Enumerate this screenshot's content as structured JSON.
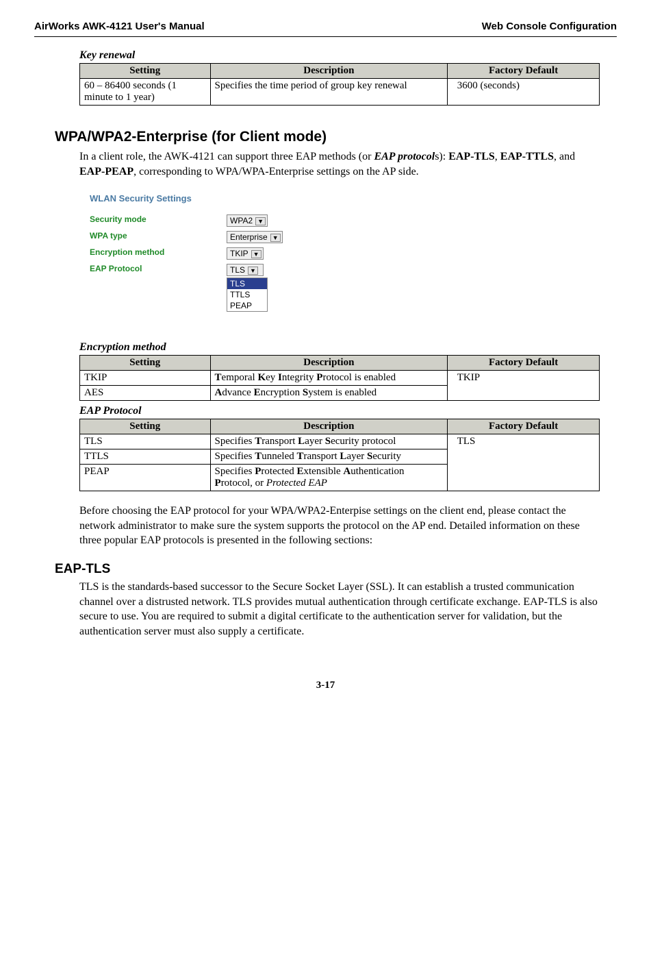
{
  "header": {
    "left": "AirWorks AWK-4121 User's Manual",
    "right": "Web Console Configuration"
  },
  "key_renewal": {
    "title": "Key renewal",
    "cols": [
      "Setting",
      "Description",
      "Factory Default"
    ],
    "rows": [
      {
        "setting": "60 – 86400 seconds (1 minute to 1 year)",
        "desc": "Specifies the time period of group key renewal",
        "def": "3600 (seconds)"
      }
    ]
  },
  "section_heading": "WPA/WPA2-Enterprise (for Client mode)",
  "intro_text_pre": "In a client role, the AWK-4121 can support three EAP methods (or ",
  "intro_eap_protocol": "EAP protocol",
  "intro_text_mid": "s): ",
  "intro_eap_tls": "EAP-TLS",
  "intro_text_comma": ", ",
  "intro_eap_ttls": "EAP-TTLS",
  "intro_text_and": ", and ",
  "intro_eap_peap": "EAP-PEAP",
  "intro_text_post": ", corresponding to WPA/WPA-Enterprise settings on the AP side.",
  "screenshot": {
    "title": "WLAN Security Settings",
    "rows": {
      "security_mode": {
        "label": "Security mode",
        "value": "WPA2"
      },
      "wpa_type": {
        "label": "WPA type",
        "value": "Enterprise"
      },
      "encryption_method": {
        "label": "Encryption method",
        "value": "TKIP"
      },
      "eap_protocol": {
        "label": "EAP Protocol",
        "value": "TLS",
        "options": [
          "TLS",
          "TTLS",
          "PEAP"
        ],
        "selected": "TLS"
      }
    }
  },
  "encryption_method": {
    "title": "Encryption method",
    "cols": [
      "Setting",
      "Description",
      "Factory Default"
    ],
    "rows": [
      {
        "setting": "TKIP",
        "desc_prefix": "T",
        "desc_mid1": "emporal ",
        "desc_key2": "K",
        "desc_mid2": "ey ",
        "desc_key3": "I",
        "desc_mid3": "ntegrity ",
        "desc_key4": "P",
        "desc_mid4": "rotocol is enabled"
      },
      {
        "setting": "AES",
        "desc_prefix": "A",
        "desc_mid1": "dvance ",
        "desc_key2": "E",
        "desc_mid2": "ncryption ",
        "desc_key3": "S",
        "desc_mid3": "ystem is enabled"
      }
    ],
    "default": "TKIP"
  },
  "eap_protocol_table": {
    "title": "EAP Protocol",
    "cols": [
      "Setting",
      "Description",
      "Factory Default"
    ],
    "rows": {
      "tls": {
        "setting": "TLS",
        "d1": "Specifies ",
        "k1": "T",
        "d2": "ransport ",
        "k2": "L",
        "d3": "ayer ",
        "k3": "S",
        "d4": "ecurity protocol"
      },
      "ttls": {
        "setting": "TTLS",
        "d1": "Specifies ",
        "k1": "T",
        "d2": "unneled ",
        "k2": "T",
        "d3": "ransport ",
        "k3": "L",
        "d4": "ayer ",
        "k4": "S",
        "d5": "ecurity"
      },
      "peap": {
        "setting": "PEAP",
        "d1": "Specifies ",
        "k1": "P",
        "d2": "rotected ",
        "k2": "E",
        "d3": "xtensible ",
        "k3": "A",
        "d4": "uthentication ",
        "k4": "P",
        "d5": "rotocol, or ",
        "it": "Protected EAP"
      }
    },
    "default": "TLS"
  },
  "middle_paragraph": "Before choosing the EAP protocol for your WPA/WPA2-Enterpise settings on the client end, please contact the network administrator to make sure the system supports the protocol on the AP end. Detailed information on these three popular EAP protocols is presented in the following sections:",
  "eap_tls": {
    "heading": "EAP-TLS",
    "text": "TLS is the standards-based successor to the Secure Socket Layer (SSL). It can establish a trusted communication channel over a distrusted network. TLS provides mutual authentication through certificate exchange. EAP-TLS is also secure to use. You are required to submit a digital certificate to the authentication server for validation, but the authentication server must also supply a certificate."
  },
  "page_number": "3-17"
}
